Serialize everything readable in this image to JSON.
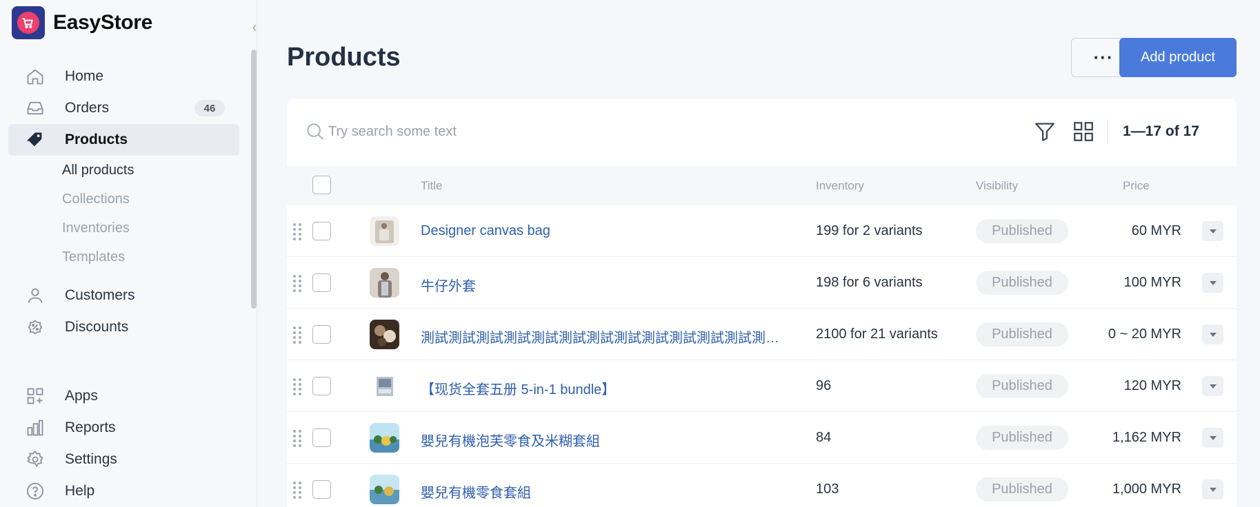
{
  "brand": {
    "name": "EasyStore"
  },
  "sidebar": {
    "items": [
      {
        "label": "Home",
        "icon": "home-icon"
      },
      {
        "label": "Orders",
        "icon": "inbox-icon",
        "badge": "46"
      },
      {
        "label": "Products",
        "icon": "tag-icon",
        "active": true
      }
    ],
    "sub_items": [
      {
        "label": "All products",
        "current": true
      },
      {
        "label": "Collections"
      },
      {
        "label": "Inventories"
      },
      {
        "label": "Templates"
      }
    ],
    "items2": [
      {
        "label": "Customers",
        "icon": "user-icon"
      },
      {
        "label": "Discounts",
        "icon": "discount-icon"
      }
    ],
    "items3": [
      {
        "label": "Apps",
        "icon": "apps-icon"
      },
      {
        "label": "Reports",
        "icon": "reports-icon"
      },
      {
        "label": "Settings",
        "icon": "gear-icon"
      },
      {
        "label": "Help",
        "icon": "help-icon"
      }
    ]
  },
  "header": {
    "title": "Products",
    "more_label": "···",
    "add_label": "Add product"
  },
  "toolbar": {
    "search_placeholder": "Try search some text",
    "pagination": "1—17 of 17"
  },
  "table": {
    "columns": {
      "title": "Title",
      "inventory": "Inventory",
      "visibility": "Visibility",
      "price": "Price"
    },
    "rows": [
      {
        "title": "Designer canvas bag",
        "inventory": "199 for 2 variants",
        "visibility": "Published",
        "price": "60 MYR",
        "thumb": "#cfc6bb"
      },
      {
        "title": "牛仔外套",
        "inventory": "198 for 6 variants",
        "visibility": "Published",
        "price": "100 MYR",
        "thumb": "#8a7f78"
      },
      {
        "title": "測試測試測試測試測試測試測試測試測試測試測試測試測試測試測試測試測試測試",
        "inventory": "2100 for 21 variants",
        "visibility": "Published",
        "price": "0 ~ 20 MYR",
        "thumb": "#5a4637"
      },
      {
        "title": "【现货全套五册 5-in-1 bundle】",
        "inventory": "96",
        "visibility": "Published",
        "price": "120 MYR",
        "thumb": "#b9c2cc"
      },
      {
        "title": "嬰兒有機泡芙零食及米糊套組",
        "inventory": "84",
        "visibility": "Published",
        "price": "1,162 MYR",
        "thumb": "#4d8fb5"
      },
      {
        "title": "嬰兒有機零食套組",
        "inventory": "103",
        "visibility": "Published",
        "price": "1,000 MYR",
        "thumb": "#5c9bbd"
      }
    ]
  },
  "colors": {
    "accent": "#4a7bdc",
    "link": "#2f5fae",
    "brand_bg": "#2b3a8f",
    "brand_mark": "#ee3f6f"
  }
}
